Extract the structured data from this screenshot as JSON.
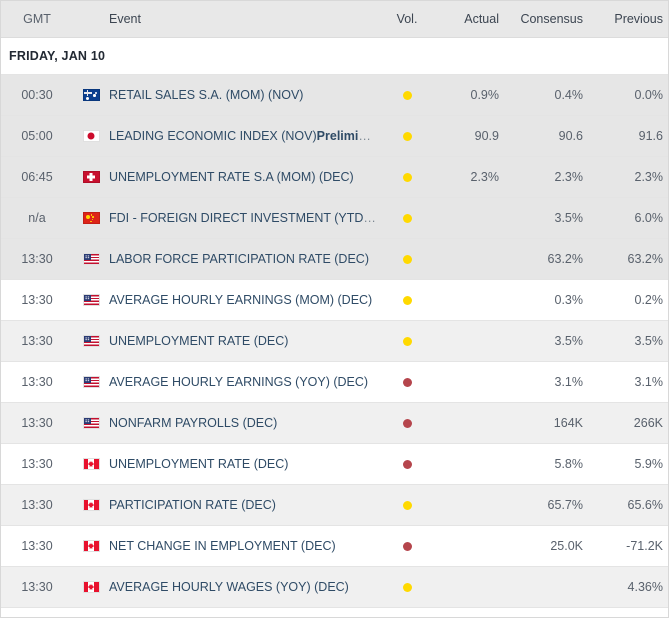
{
  "header": {
    "time_label": "GMT",
    "event_label": "Event",
    "vol_label": "Vol.",
    "actual_label": "Actual",
    "consensus_label": "Consensus",
    "previous_label": "Previous"
  },
  "day_group": {
    "label": "FRIDAY, JAN 10"
  },
  "colors": {
    "volatility_medium": "#ffd900",
    "volatility_high": "#b5454c",
    "event_link": "#2f4b66",
    "header_bg": "#e8e8e8",
    "row_shade": "#e6e6e6",
    "row_alt": "#f0f0f0"
  },
  "rows": [
    {
      "time": "00:30",
      "country": "australia",
      "flag": "au",
      "event": "RETAIL SALES S.A. (MOM) (NOV)",
      "event_tag": "",
      "truncated": false,
      "volatility": "medium",
      "actual": "0.9%",
      "consensus": "0.4%",
      "previous": "0.0%",
      "shade": "sh"
    },
    {
      "time": "05:00",
      "country": "japan",
      "flag": "jp",
      "event": "LEADING ECONOMIC INDEX (NOV)",
      "event_tag": "Prelimi",
      "truncated": true,
      "volatility": "medium",
      "actual": "90.9",
      "consensus": "90.6",
      "previous": "91.6",
      "shade": "sh"
    },
    {
      "time": "06:45",
      "country": "switzerland",
      "flag": "ch",
      "event": "UNEMPLOYMENT RATE S.A (MOM) (DEC)",
      "event_tag": "",
      "truncated": false,
      "volatility": "medium",
      "actual": "2.3%",
      "consensus": "2.3%",
      "previous": "2.3%",
      "shade": "sh"
    },
    {
      "time": "n/a",
      "country": "china",
      "flag": "cn",
      "event": "FDI - FOREIGN DIRECT INVESTMENT (YTD",
      "event_tag": "",
      "truncated": true,
      "volatility": "medium",
      "actual": "",
      "consensus": "3.5%",
      "previous": "6.0%",
      "shade": "sh"
    },
    {
      "time": "13:30",
      "country": "united-states",
      "flag": "us",
      "event": "LABOR FORCE PARTICIPATION RATE (DEC)",
      "event_tag": "",
      "truncated": false,
      "volatility": "medium",
      "actual": "",
      "consensus": "63.2%",
      "previous": "63.2%",
      "shade": "sh"
    },
    {
      "time": "13:30",
      "country": "united-states",
      "flag": "us",
      "event": "AVERAGE HOURLY EARNINGS (MOM) (DEC)",
      "event_tag": "",
      "truncated": false,
      "volatility": "medium",
      "actual": "",
      "consensus": "0.3%",
      "previous": "0.2%",
      "shade": "wh"
    },
    {
      "time": "13:30",
      "country": "united-states",
      "flag": "us",
      "event": "UNEMPLOYMENT RATE (DEC)",
      "event_tag": "",
      "truncated": false,
      "volatility": "medium",
      "actual": "",
      "consensus": "3.5%",
      "previous": "3.5%",
      "shade": "lg"
    },
    {
      "time": "13:30",
      "country": "united-states",
      "flag": "us",
      "event": "AVERAGE HOURLY EARNINGS (YOY) (DEC)",
      "event_tag": "",
      "truncated": false,
      "volatility": "high",
      "actual": "",
      "consensus": "3.1%",
      "previous": "3.1%",
      "shade": "wh"
    },
    {
      "time": "13:30",
      "country": "united-states",
      "flag": "us",
      "event": "NONFARM PAYROLLS (DEC)",
      "event_tag": "",
      "truncated": false,
      "volatility": "high",
      "actual": "",
      "consensus": "164K",
      "previous": "266K",
      "shade": "lg"
    },
    {
      "time": "13:30",
      "country": "canada",
      "flag": "ca",
      "event": "UNEMPLOYMENT RATE (DEC)",
      "event_tag": "",
      "truncated": false,
      "volatility": "high",
      "actual": "",
      "consensus": "5.8%",
      "previous": "5.9%",
      "shade": "wh"
    },
    {
      "time": "13:30",
      "country": "canada",
      "flag": "ca",
      "event": "PARTICIPATION RATE (DEC)",
      "event_tag": "",
      "truncated": false,
      "volatility": "medium",
      "actual": "",
      "consensus": "65.7%",
      "previous": "65.6%",
      "shade": "lg"
    },
    {
      "time": "13:30",
      "country": "canada",
      "flag": "ca",
      "event": "NET CHANGE IN EMPLOYMENT (DEC)",
      "event_tag": "",
      "truncated": false,
      "volatility": "high",
      "actual": "",
      "consensus": "25.0K",
      "previous": "-71.2K",
      "shade": "wh"
    },
    {
      "time": "13:30",
      "country": "canada",
      "flag": "ca",
      "event": "AVERAGE HOURLY WAGES (YOY) (DEC)",
      "event_tag": "",
      "truncated": false,
      "volatility": "medium",
      "actual": "",
      "consensus": "",
      "previous": "4.36%",
      "shade": "lg"
    }
  ]
}
